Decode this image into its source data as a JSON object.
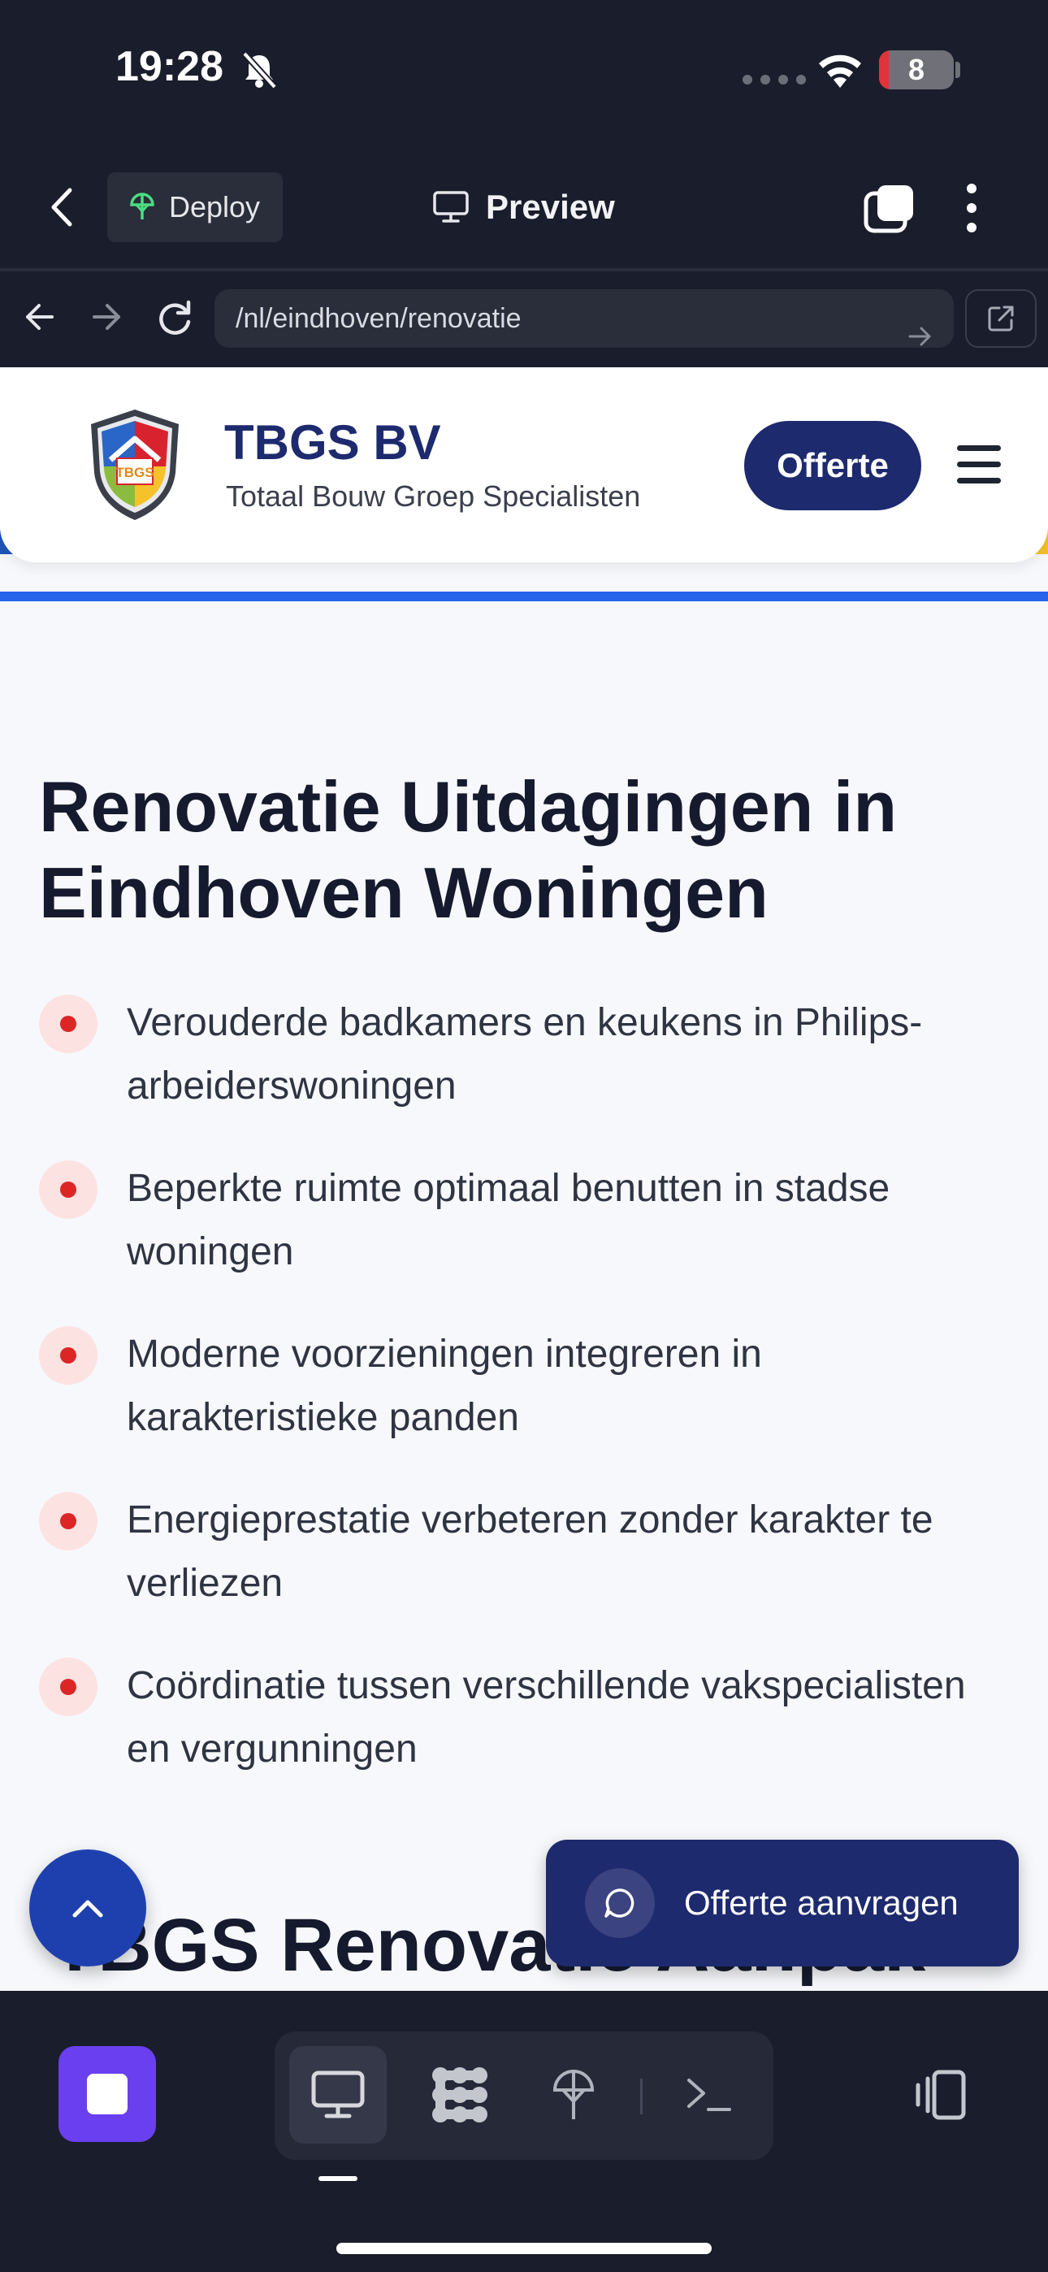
{
  "status_bar": {
    "time": "19:28",
    "battery": "8"
  },
  "app_header": {
    "deploy_label": "Deploy",
    "title": "Preview"
  },
  "url_bar": {
    "url": "/nl/eindhoven/renovatie"
  },
  "site": {
    "brand_name": "TBGS BV",
    "brand_tagline": "Totaal Bouw Groep Specialisten",
    "logo_text": "TBGS",
    "cta_label": "Offerte",
    "stripe_colors": [
      "#1f56b8",
      "#d42030",
      "#8cbc3f",
      "#f5c22b"
    ]
  },
  "content": {
    "heading": "Renovatie Uitdagingen in Eindhoven Woningen",
    "items": [
      "Verouderde badkamers en keukens in Philips-arbeiderswoningen",
      "Beperkte ruimte optimaal benutten in stadse woningen",
      "Moderne voorzieningen integreren in karakteristieke panden",
      "Energieprestatie verbeteren zonder karakter te verliezen",
      "Coördinatie tussen verschillende vakspecialisten en vergunningen"
    ],
    "next_heading": "TBGS Renovatie Aanpak"
  },
  "floating": {
    "request_quote_label": "Offerte aanvragen"
  },
  "toolbar": {
    "active_mode": "desktop"
  },
  "colors": {
    "navy": "#1e2a6e",
    "accent_red": "#dc2626",
    "toolbar_bg": "#1a1d2b",
    "stop_purple": "#6a3ff0"
  }
}
